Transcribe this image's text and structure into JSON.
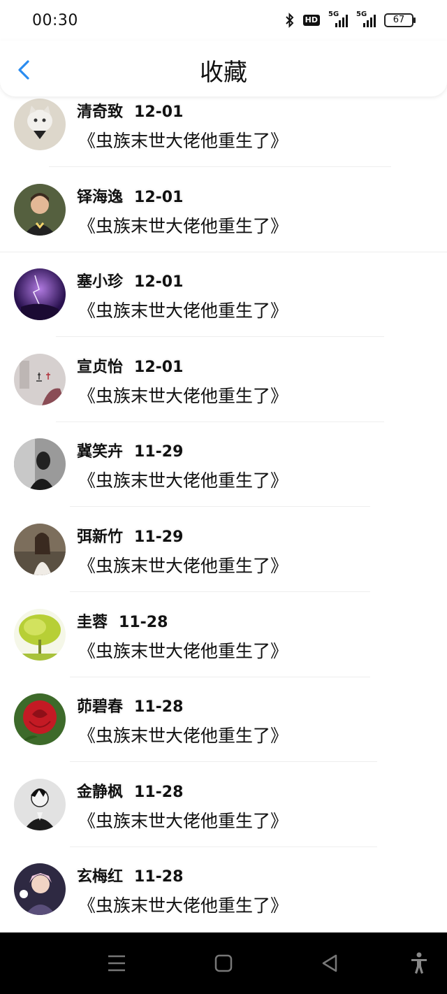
{
  "status_bar": {
    "time": "00:30",
    "hd_label": "HD",
    "net1": "5G",
    "net2": "5G",
    "battery": "67"
  },
  "header": {
    "title": "收藏"
  },
  "items": [
    {
      "name": "清奇致",
      "date": "12-01",
      "book": "《虫族末世大佬他重生了》",
      "avatar_color": "#d8d2c6"
    },
    {
      "name": "铎海逸",
      "date": "12-01",
      "book": "《虫族末世大佬他重生了》",
      "avatar_color": "#3a4a2e"
    },
    {
      "name": "塞小珍",
      "date": "12-01",
      "book": "《虫族末世大佬他重生了》",
      "avatar_color": "#4a2a7a"
    },
    {
      "name": "宣贞怡",
      "date": "12-01",
      "book": "《虫族末世大佬他重生了》",
      "avatar_color": "#c9c4c2"
    },
    {
      "name": "冀笑卉",
      "date": "11-29",
      "book": "《虫族末世大佬他重生了》",
      "avatar_color": "#7a7a7a"
    },
    {
      "name": "弭新竹",
      "date": "11-29",
      "book": "《虫族末世大佬他重生了》",
      "avatar_color": "#8a7a68"
    },
    {
      "name": "圭蓉",
      "date": "11-28",
      "book": "《虫族末世大佬他重生了》",
      "avatar_color": "#b9cf3c"
    },
    {
      "name": "茆碧春",
      "date": "11-28",
      "book": "《虫族末世大佬他重生了》",
      "avatar_color": "#c0222a"
    },
    {
      "name": "金静枫",
      "date": "11-28",
      "book": "《虫族末世大佬他重生了》",
      "avatar_color": "#d9d9d9"
    },
    {
      "name": "玄梅红",
      "date": "11-28",
      "book": "《虫族末世大佬他重生了》",
      "avatar_color": "#3a3350"
    }
  ],
  "colors": {
    "accent": "#2a8cf0",
    "text": "#111111",
    "divider": "#eeeeee",
    "nav_bar": "#000000"
  },
  "icons": {
    "back": "chevron-left-icon",
    "bluetooth": "bluetooth-icon",
    "menu": "menu-icon",
    "home": "home-icon",
    "back_nav": "back-triangle-icon",
    "accessibility": "accessibility-icon"
  }
}
